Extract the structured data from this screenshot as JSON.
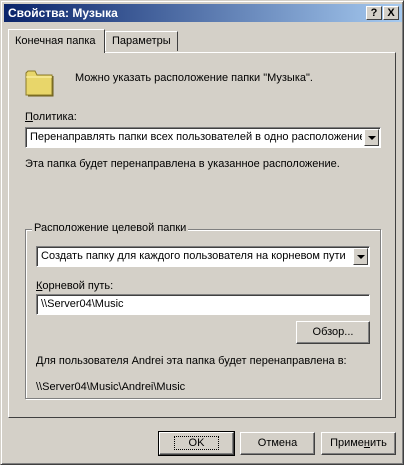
{
  "window": {
    "title": "Свойства: Музыка",
    "help_button": "?",
    "close_button": "X"
  },
  "tabs": [
    {
      "label": "Конечная папка",
      "active": true
    },
    {
      "label": "Параметры",
      "active": false
    }
  ],
  "intro_text": "Можно указать расположение папки \"Музыка\".",
  "policy": {
    "label_prefix": "П",
    "label_rest": "олитика:",
    "value": "Перенаправлять папки всех пользователей в одно расположение",
    "description": "Эта папка будет перенаправлена в указанное расположение."
  },
  "target_group": {
    "legend": "Расположение целевой папки",
    "location_value": "Создать папку для каждого пользователя на корневом пути",
    "root_label_prefix": "К",
    "root_label_rest": "орневой путь:",
    "root_path": "\\\\Server04\\Music",
    "browse_label": "Обзор...",
    "result_label": "Для пользователя Andrei эта папка будет перенаправлена в:",
    "result_path": "\\\\Server04\\Music\\Andrei\\Music"
  },
  "footer": {
    "ok_label": "OK",
    "cancel_label": "Отмена",
    "apply_prefix": "Приме",
    "apply_underlined": "н",
    "apply_suffix": "ить"
  },
  "colors": {
    "titlebar_start": "#0a246a",
    "titlebar_end": "#a6caf0",
    "face": "#d4d0c8",
    "folder_fill": "#e8d66a"
  }
}
